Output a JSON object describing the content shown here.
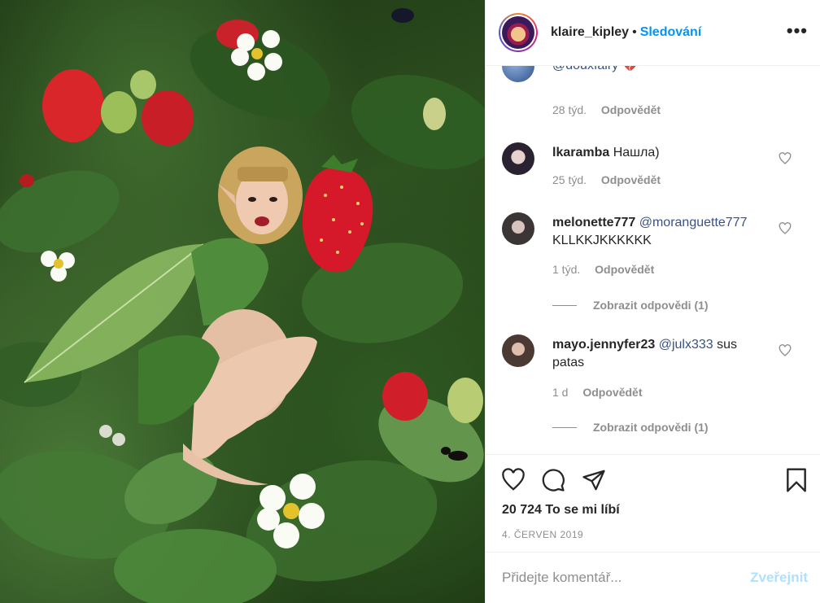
{
  "post": {
    "owner": "klaire_kipley",
    "separator": "•",
    "follow_label": "Sledování",
    "more_label": "•••",
    "image_alt": "Fairy holding a giant strawberry among strawberry leaves"
  },
  "comments": [
    {
      "user": "",
      "mention": "@douxfairy",
      "text": "",
      "emoji": "💔",
      "time": "28 týd.",
      "reply_label": "Odpovědět",
      "avatar_color": "#5a7fb5"
    },
    {
      "user": "lkaramba",
      "mention": "",
      "text": "Нашла)",
      "time": "25 týd.",
      "reply_label": "Odpovědět",
      "avatar_color": "#2a2230"
    },
    {
      "user": "melonette777",
      "mention": "@moranguette777",
      "text": "KLLKKJKKKKKK",
      "time": "1 týd.",
      "reply_label": "Odpovědět",
      "view_replies": "Zobrazit odpovědi (1)",
      "avatar_color": "#3b3536"
    },
    {
      "user": "mayo.jennyfer23",
      "mention": "@julx333",
      "text": "sus patas",
      "time": "1 d",
      "reply_label": "Odpovědět",
      "view_replies": "Zobrazit odpovědi (1)",
      "avatar_color": "#4a3a33"
    }
  ],
  "actions": {
    "like_icon": "heart-icon",
    "comment_icon": "comment-icon",
    "share_icon": "share-icon",
    "save_icon": "bookmark-icon",
    "likes_text": "20 724 To se mi líbí",
    "date_text": "4. ČERVEN 2019"
  },
  "add_comment": {
    "placeholder": "Přidejte komentář...",
    "post_label": "Zveřejnit"
  },
  "colors": {
    "accent": "#0095f6",
    "mention": "#385185",
    "post_disabled": "#b2dffc",
    "muted": "#8e8e8e"
  }
}
